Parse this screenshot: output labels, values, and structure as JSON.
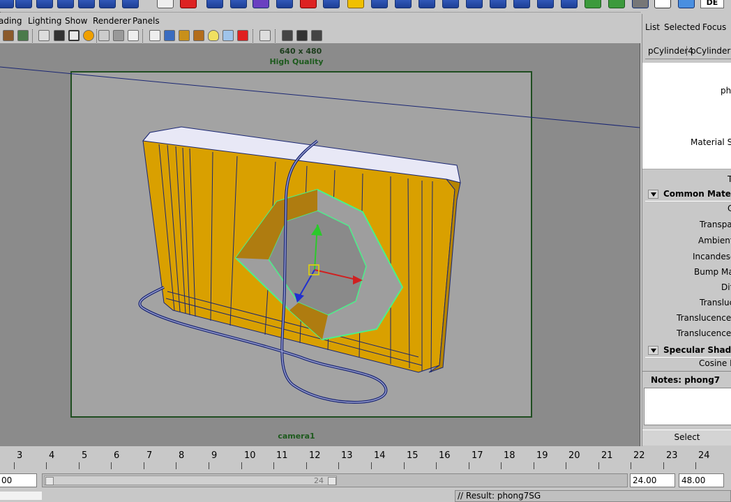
{
  "menu": [
    "ading",
    "Lighting",
    "Show",
    "Renderer",
    "Panels"
  ],
  "viewport": {
    "resolution_label": "640 x 480",
    "quality_label": "High Quality",
    "camera_label": "camera1"
  },
  "attribute_editor": {
    "menu": [
      "List",
      "Selected",
      "Focus"
    ],
    "tabs": [
      "pCylinder4",
      "pCylinderSha"
    ],
    "type_label": "pho",
    "material_sample_label": "Material Sam",
    "type_row": "T",
    "sections": {
      "common": "Common Material",
      "specular": "Specular Shading"
    },
    "common_attrs": [
      "C",
      "Transpare",
      "Ambient C",
      "Incandesce",
      "Bump Mapp",
      "Diff",
      "Transluce",
      "Translucence De",
      "Translucence Fo"
    ],
    "specular_attrs": [
      "Cosine Po"
    ],
    "notes_label": "Notes:  phong7",
    "select_button": "Select"
  },
  "timeline": {
    "ticks": [
      "3",
      "4",
      "5",
      "6",
      "7",
      "8",
      "9",
      "10",
      "11",
      "12",
      "13",
      "14",
      "15",
      "16",
      "17",
      "18",
      "19",
      "20",
      "21",
      "22",
      "23",
      "24"
    ],
    "start_field": "00",
    "slider_end_label": "24",
    "end_time": "24.00",
    "range_end": "48.00"
  },
  "command_line": {
    "result": "// Result: phong7SG"
  },
  "status": {
    "lang": "DE"
  },
  "colors": {
    "object": "#d9a000",
    "wire": "#1a2673",
    "selection": "#4cf08a",
    "gate_border": "#1f4d20"
  }
}
